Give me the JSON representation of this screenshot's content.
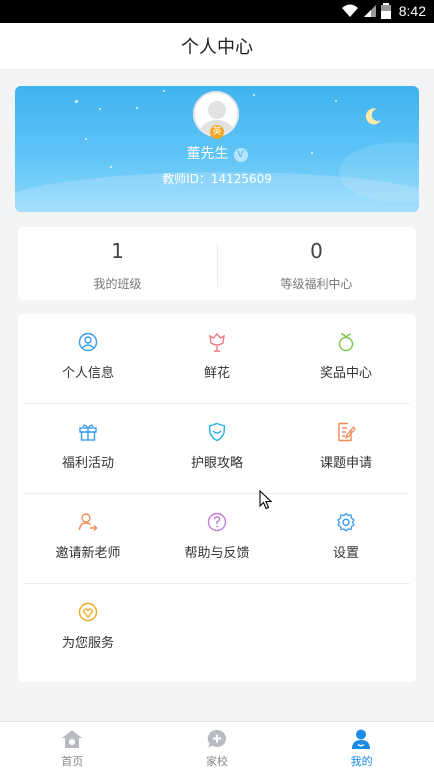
{
  "status_bar": {
    "time": "8:42"
  },
  "header": {
    "title": "个人中心"
  },
  "profile": {
    "badge": "英",
    "name": "董先生",
    "verified_mark": "V",
    "teacher_id": "教师ID：14125609"
  },
  "stats": [
    {
      "value": "1",
      "label": "我的班级"
    },
    {
      "value": "0",
      "label": "等级福利中心"
    }
  ],
  "menu": [
    {
      "label": "个人信息",
      "icon": "user-circle-icon",
      "color": "#3a9be8"
    },
    {
      "label": "鲜花",
      "icon": "flower-icon",
      "color": "#f07a88"
    },
    {
      "label": "奖品中心",
      "icon": "fruit-icon",
      "color": "#7cc34a"
    },
    {
      "label": "福利活动",
      "icon": "gift-icon",
      "color": "#3a9be8"
    },
    {
      "label": "护眼攻略",
      "icon": "eye-shield-icon",
      "color": "#2aaee6"
    },
    {
      "label": "课题申请",
      "icon": "edit-document-icon",
      "color": "#f28c5a"
    },
    {
      "label": "邀请新老师",
      "icon": "invite-user-icon",
      "color": "#f28c5a"
    },
    {
      "label": "帮助与反馈",
      "icon": "help-icon",
      "color": "#c57be0"
    },
    {
      "label": "设置",
      "icon": "gear-icon",
      "color": "#3a9be8"
    },
    {
      "label": "为您服务",
      "icon": "heart-service-icon",
      "color": "#f5a623"
    }
  ],
  "tabs": [
    {
      "label": "首页",
      "icon": "home-icon",
      "active": false
    },
    {
      "label": "家校",
      "icon": "chat-add-icon",
      "active": false
    },
    {
      "label": "我的",
      "icon": "user-icon",
      "active": true
    }
  ],
  "colors": {
    "accent": "#1a8ae6",
    "card_gradient_top": "#3fb3f0"
  }
}
